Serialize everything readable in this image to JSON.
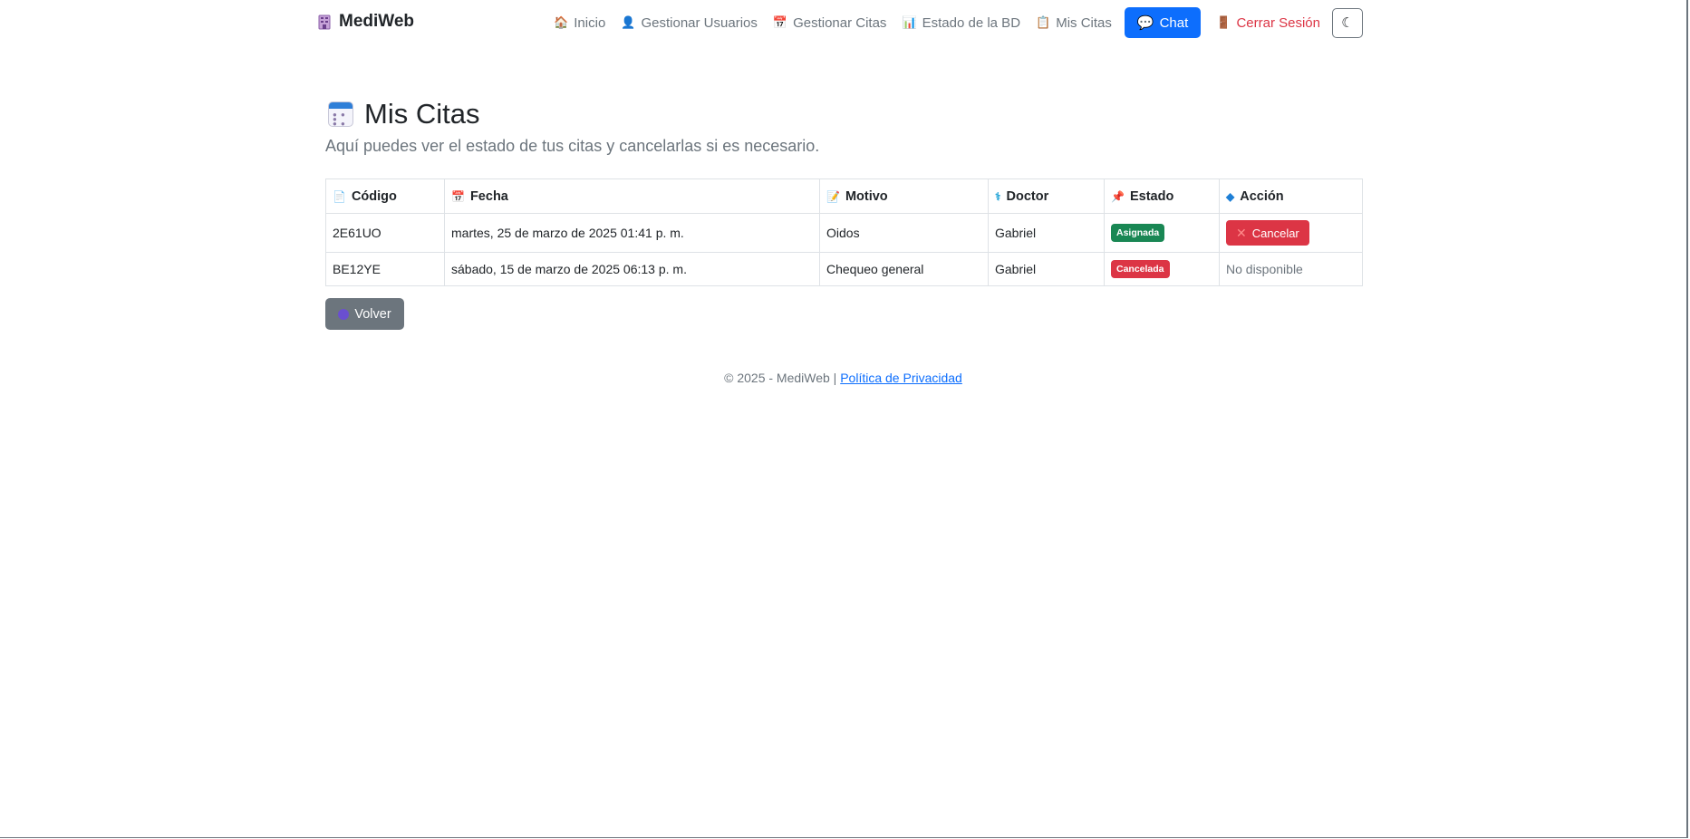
{
  "navbar": {
    "brand": "MediWeb",
    "brand_icon": "building-icon",
    "links": [
      {
        "label": "Inicio",
        "icon": "house-icon"
      },
      {
        "label": "Gestionar Usuarios",
        "icon": "user-icon"
      },
      {
        "label": "Gestionar Citas",
        "icon": "calendar-icon"
      },
      {
        "label": "Estado de la BD",
        "icon": "bar-chart-icon"
      },
      {
        "label": "Mis Citas",
        "icon": "clipboard-icon"
      }
    ],
    "chat_label": "Chat",
    "logout_label": "Cerrar Sesión",
    "theme_icon": "moon-icon"
  },
  "main": {
    "title": "Mis Citas",
    "subtitle": "Aquí puedes ver el estado de tus citas y cancelarlas si es necesario."
  },
  "table": {
    "headers": [
      "Código",
      "Fecha",
      "Motivo",
      "Doctor",
      "Estado",
      "Acción"
    ],
    "rows": [
      {
        "codigo": "2E61UO",
        "fecha": "martes, 25 de marzo de 2025 01:41 p. m.",
        "motivo": "Oidos",
        "doctor": "Gabriel",
        "estado": "Asignada",
        "accion": "Cancelar"
      },
      {
        "codigo": "BE12YE",
        "fecha": "sábado, 15 de marzo de 2025 06:13 p. m.",
        "motivo": "Chequeo general",
        "doctor": "Gabriel",
        "estado": "Cancelada",
        "accion": "No disponible"
      }
    ]
  },
  "back_label": "Volver",
  "footer": {
    "copyright": "© 2025 - MediWeb |",
    "privacy_link": "Política de Privacidad"
  },
  "colors": {
    "primary": "#0d6efd",
    "danger": "#dc3545",
    "success": "#198754",
    "secondary": "#6c757d"
  }
}
